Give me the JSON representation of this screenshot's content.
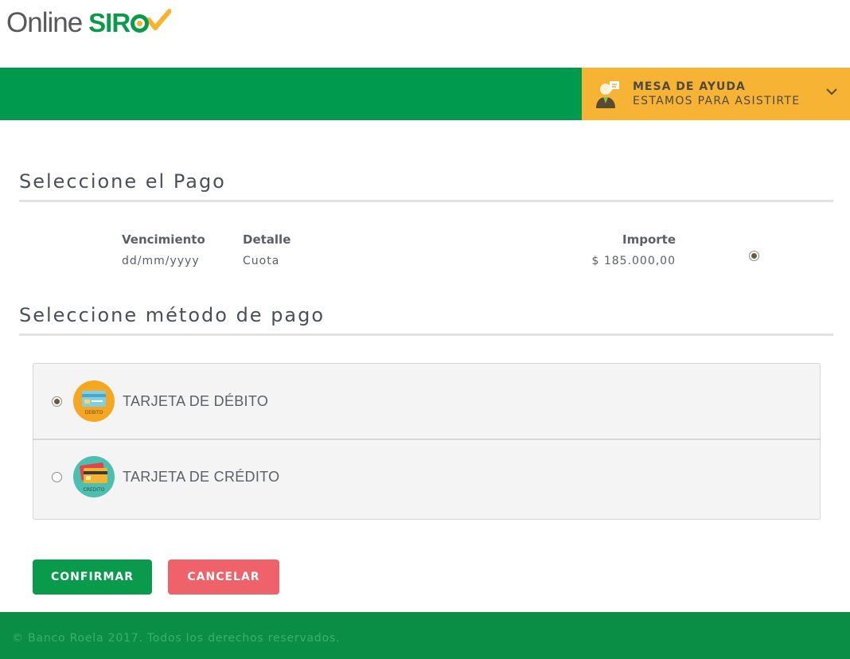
{
  "header": {
    "logo_online": "Online",
    "logo_siro": "SIR",
    "help": {
      "title": "MESA DE AYUDA",
      "subtitle": "ESTAMOS PARA ASISTIRTE"
    }
  },
  "payment_section": {
    "title": "Seleccione el Pago",
    "columns": {
      "due": "Vencimiento",
      "detail": "Detalle",
      "amount": "Importe"
    },
    "row": {
      "due": "dd/mm/yyyy",
      "detail": "Cuota",
      "amount": "$ 185.000,00",
      "selected": true
    }
  },
  "method_section": {
    "title": "Seleccione método de pago",
    "methods": [
      {
        "label": "TARJETA DE DÉBITO",
        "icon_caption": "DEBITO",
        "icon": "debit-card-icon",
        "color": "#f5a623",
        "selected": true
      },
      {
        "label": "TARJETA DE CRÉDITO",
        "icon_caption": "CREDITO",
        "icon": "credit-card-icon",
        "color": "#4dbfb0",
        "selected": false
      }
    ]
  },
  "actions": {
    "confirm": "CONFIRMAR",
    "cancel": "CANCELAR"
  },
  "footer": {
    "text": "© Banco Roela 2017. Todos los derechos reservados."
  },
  "colors": {
    "brand_green": "#009a4e",
    "help_yellow": "#f7b334",
    "cancel_red": "#f0626a",
    "footer_green": "#0a8e45"
  }
}
